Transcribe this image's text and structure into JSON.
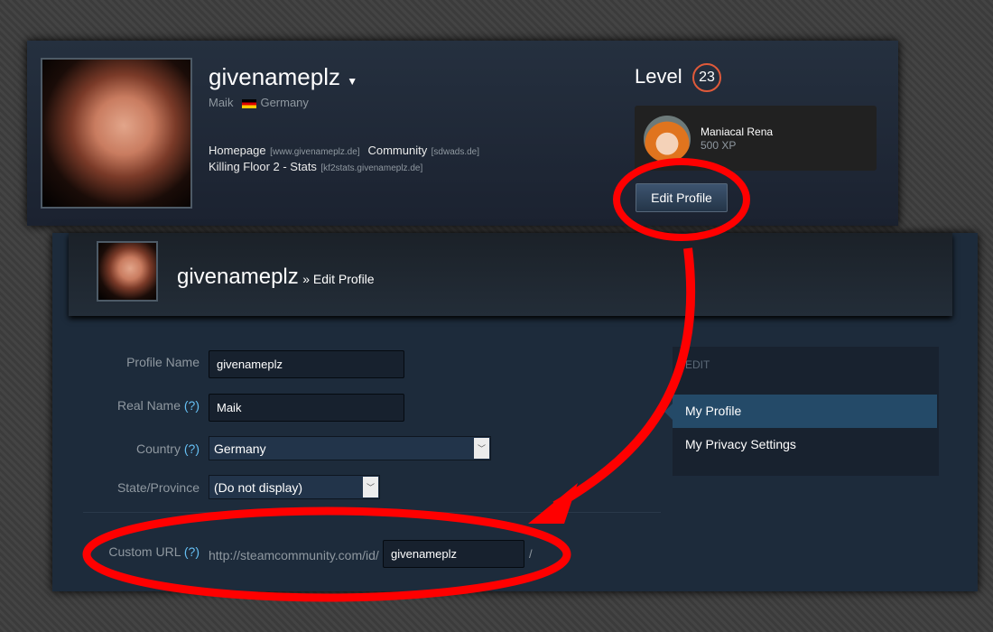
{
  "profile": {
    "name": "givenameplz",
    "real_name": "Maik",
    "country": "Germany",
    "links": [
      {
        "label": "Homepage",
        "url": "[www.givenameplz.de]"
      },
      {
        "label": "Community",
        "url": "[sdwads.de]"
      },
      {
        "label": "Killing Floor 2 - Stats",
        "url": "[kf2stats.givenameplz.de]"
      }
    ],
    "level_label": "Level",
    "level": "23",
    "badge": {
      "name": "Maniacal Rena",
      "xp": "500 XP"
    },
    "edit_button": "Edit Profile"
  },
  "edit": {
    "username": "givenameplz",
    "crumb": "» Edit Profile",
    "fields": {
      "profile_name_label": "Profile Name",
      "profile_name": "givenameplz",
      "real_name_label": "Real Name",
      "real_name": "Maik",
      "help": "(?)",
      "country_label": "Country",
      "country": "Germany",
      "state_label": "State/Province",
      "state": "(Do not display)",
      "custom_url_label": "Custom URL",
      "url_prefix": "http://steamcommunity.com/id/",
      "custom_url": "givenameplz",
      "url_suffix": "/"
    },
    "side": {
      "title": "EDIT",
      "items": [
        "My Profile",
        "My Privacy Settings"
      ],
      "active": 0
    }
  },
  "colors": {
    "annotation": "#ff0000",
    "accent": "#66c0f4",
    "level_ring": "#e05a3a"
  }
}
